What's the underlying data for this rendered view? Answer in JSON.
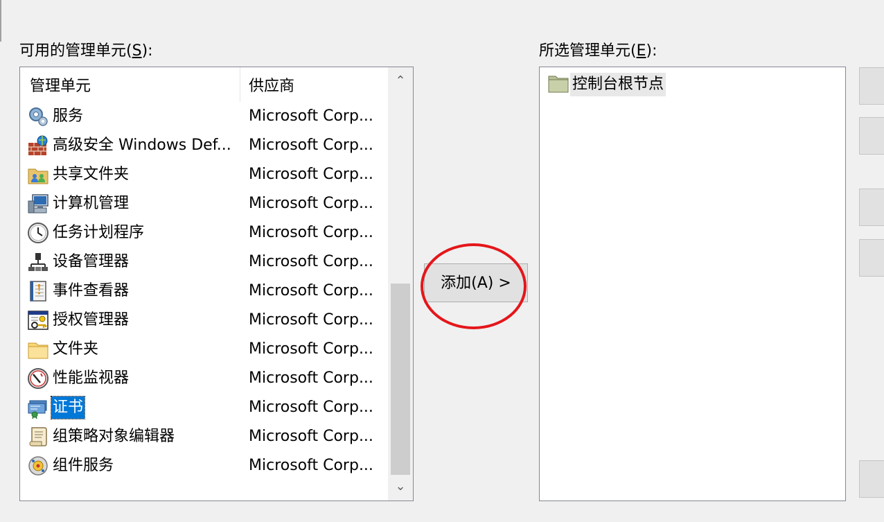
{
  "available": {
    "label_text": "可用的管理单元(",
    "label_key": "S",
    "label_end": "):",
    "columns": {
      "name": "管理单元",
      "vendor": "供应商"
    },
    "items": [
      {
        "name": "服务",
        "vendor": "Microsoft Corp...",
        "icon": "gear-services-icon"
      },
      {
        "name": "高级安全 Windows Def...",
        "vendor": "Microsoft Corp...",
        "icon": "firewall-icon"
      },
      {
        "name": "共享文件夹",
        "vendor": "Microsoft Corp...",
        "icon": "shared-folder-icon"
      },
      {
        "name": "计算机管理",
        "vendor": "Microsoft Corp...",
        "icon": "computer-management-icon"
      },
      {
        "name": "任务计划程序",
        "vendor": "Microsoft Corp...",
        "icon": "clock-icon"
      },
      {
        "name": "设备管理器",
        "vendor": "Microsoft Corp...",
        "icon": "device-manager-icon"
      },
      {
        "name": "事件查看器",
        "vendor": "Microsoft Corp...",
        "icon": "event-viewer-icon"
      },
      {
        "name": "授权管理器",
        "vendor": "Microsoft Corp...",
        "icon": "authorization-manager-icon"
      },
      {
        "name": "文件夹",
        "vendor": "Microsoft Corp...",
        "icon": "folder-icon"
      },
      {
        "name": "性能监视器",
        "vendor": "Microsoft Corp...",
        "icon": "performance-monitor-icon"
      },
      {
        "name": "证书",
        "vendor": "Microsoft Corp...",
        "icon": "certificate-icon"
      },
      {
        "name": "组策略对象编辑器",
        "vendor": "Microsoft Corp...",
        "icon": "group-policy-icon"
      },
      {
        "name": "组件服务",
        "vendor": "Microsoft Corp...",
        "icon": "component-services-icon"
      }
    ],
    "selected_index": 10
  },
  "add_button": {
    "label": "添加(A) >"
  },
  "selected": {
    "label_text": "所选管理单元(",
    "label_key": "E",
    "label_end": "):",
    "root_node": {
      "name": "控制台根节点",
      "icon": "console-root-folder-icon"
    }
  },
  "colors": {
    "selection": "#0078d7",
    "highlight_ring": "#e4161a",
    "background": "#f0f0f0"
  }
}
